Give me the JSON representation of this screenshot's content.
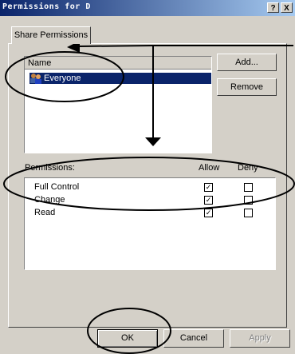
{
  "window": {
    "title": "Permissions for D",
    "help_btn": "?",
    "close_btn": "X"
  },
  "tabs": [
    {
      "label": "Share Permissions"
    }
  ],
  "users": {
    "column_header": "Name",
    "items": [
      {
        "name": "Everyone",
        "icon": "group-icon",
        "selected": true
      }
    ]
  },
  "buttons": {
    "add": "Add...",
    "remove": "Remove",
    "ok": "OK",
    "cancel": "Cancel",
    "apply": "Apply"
  },
  "permissions": {
    "label": "Permissions:",
    "allow_header": "Allow",
    "deny_header": "Deny",
    "rows": [
      {
        "name": "Full Control",
        "allow": true,
        "deny": false
      },
      {
        "name": "Change",
        "allow": true,
        "deny": false
      },
      {
        "name": "Read",
        "allow": true,
        "deny": false
      }
    ]
  },
  "colors": {
    "title_start": "#0a246a",
    "title_end": "#a6caf0",
    "selection": "#0a246a",
    "face": "#d4d0c8"
  }
}
